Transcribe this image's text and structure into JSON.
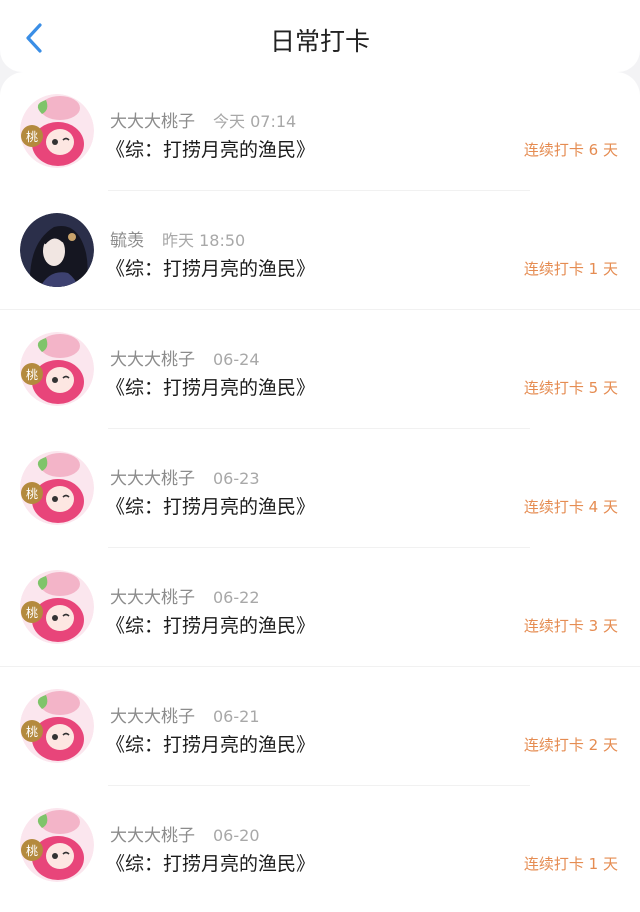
{
  "header": {
    "title": "日常打卡",
    "back_icon": "chevron-left-icon",
    "accent": "#3a8ee6"
  },
  "entries": [
    {
      "user": "大大大桃子",
      "time": "今天 07:14",
      "book": "《综：打捞月亮的渔民》",
      "streak": "连续打卡 6 天",
      "avatar": "peach-girl"
    },
    {
      "user": "毓羡",
      "time": "昨天 18:50",
      "book": "《综：打捞月亮的渔民》",
      "streak": "连续打卡 1 天",
      "avatar": "ink-portrait"
    },
    {
      "user": "大大大桃子",
      "time": "06-24",
      "book": "《综：打捞月亮的渔民》",
      "streak": "连续打卡 5 天",
      "avatar": "peach-girl"
    },
    {
      "user": "大大大桃子",
      "time": "06-23",
      "book": "《综：打捞月亮的渔民》",
      "streak": "连续打卡 4 天",
      "avatar": "peach-girl"
    },
    {
      "user": "大大大桃子",
      "time": "06-22",
      "book": "《综：打捞月亮的渔民》",
      "streak": "连续打卡 3 天",
      "avatar": "peach-girl"
    },
    {
      "user": "大大大桃子",
      "time": "06-21",
      "book": "《综：打捞月亮的渔民》",
      "streak": "连续打卡 2 天",
      "avatar": "peach-girl"
    },
    {
      "user": "大大大桃子",
      "time": "06-20",
      "book": "《综：打捞月亮的渔民》",
      "streak": "连续打卡 1 天",
      "avatar": "peach-girl"
    }
  ],
  "colors": {
    "streak": "#e58c52",
    "meta": "#9a9a9a",
    "title": "#222222"
  }
}
